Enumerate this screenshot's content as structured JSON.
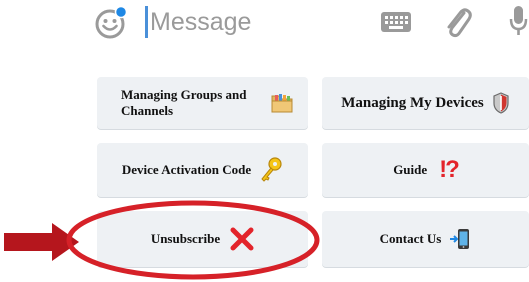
{
  "message_bar": {
    "placeholder": "Message",
    "icons": {
      "emoji": "smiley-face-icon",
      "keyboard": "keyboard-icon",
      "attach": "paperclip-icon",
      "mic": "microphone-icon"
    },
    "colors": {
      "emoji_badge": "#1e88e5",
      "caret": "#4a90d9",
      "icon_gray": "#9a9a9a"
    }
  },
  "keyboard_buttons": [
    {
      "label": "Managing Groups and Channels",
      "icon": "folder-icon"
    },
    {
      "label": "Managing My Devices",
      "icon": "shield-icon"
    },
    {
      "label": "Device Activation Code",
      "icon": "key-icon"
    },
    {
      "label": "Guide",
      "icon": "exclamation-question-icon",
      "icon_text": "!?"
    },
    {
      "label": "Unsubscribe",
      "icon": "cross-mark-icon"
    },
    {
      "label": "Contact Us",
      "icon": "phone-arrow-icon"
    }
  ],
  "annotation": {
    "highlight_target": "Unsubscribe",
    "arrow_color": "#b5161d",
    "ellipse_color": "#d62128"
  }
}
